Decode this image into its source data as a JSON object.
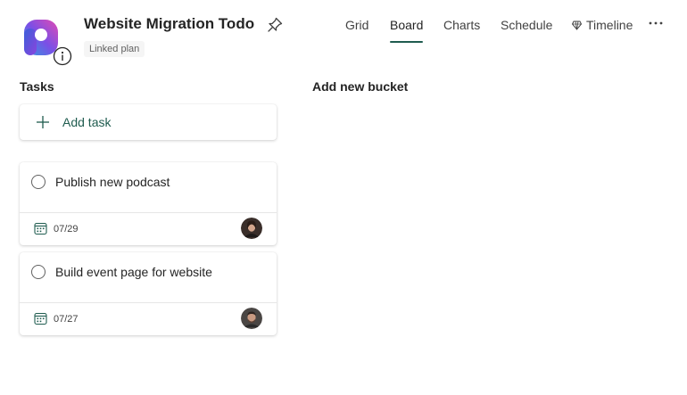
{
  "header": {
    "plan_title": "Website Migration Todo",
    "linked_badge": "Linked plan"
  },
  "nav": {
    "tabs": [
      {
        "label": "Grid",
        "active": false
      },
      {
        "label": "Board",
        "active": true
      },
      {
        "label": "Charts",
        "active": false
      },
      {
        "label": "Schedule",
        "active": false
      },
      {
        "label": "Timeline",
        "active": false
      }
    ],
    "more_label": "···"
  },
  "board": {
    "bucket_title": "Tasks",
    "add_task_label": "Add task",
    "add_bucket_label": "Add new bucket",
    "tasks": [
      {
        "title": "Publish new podcast",
        "due": "07/29"
      },
      {
        "title": "Build event page for website",
        "due": "07/27"
      }
    ]
  },
  "colors": {
    "accent": "#1f5c4f",
    "text": "#242424",
    "logo_gradient": [
      "#2f7bd9",
      "#9b3fe0",
      "#e14bb4"
    ]
  },
  "icons": [
    "planner-logo-icon",
    "info-icon",
    "pin-icon",
    "timeline-diamond-icon",
    "more-icon",
    "plus-icon",
    "checkbox-circle-icon",
    "calendar-icon",
    "avatar"
  ]
}
